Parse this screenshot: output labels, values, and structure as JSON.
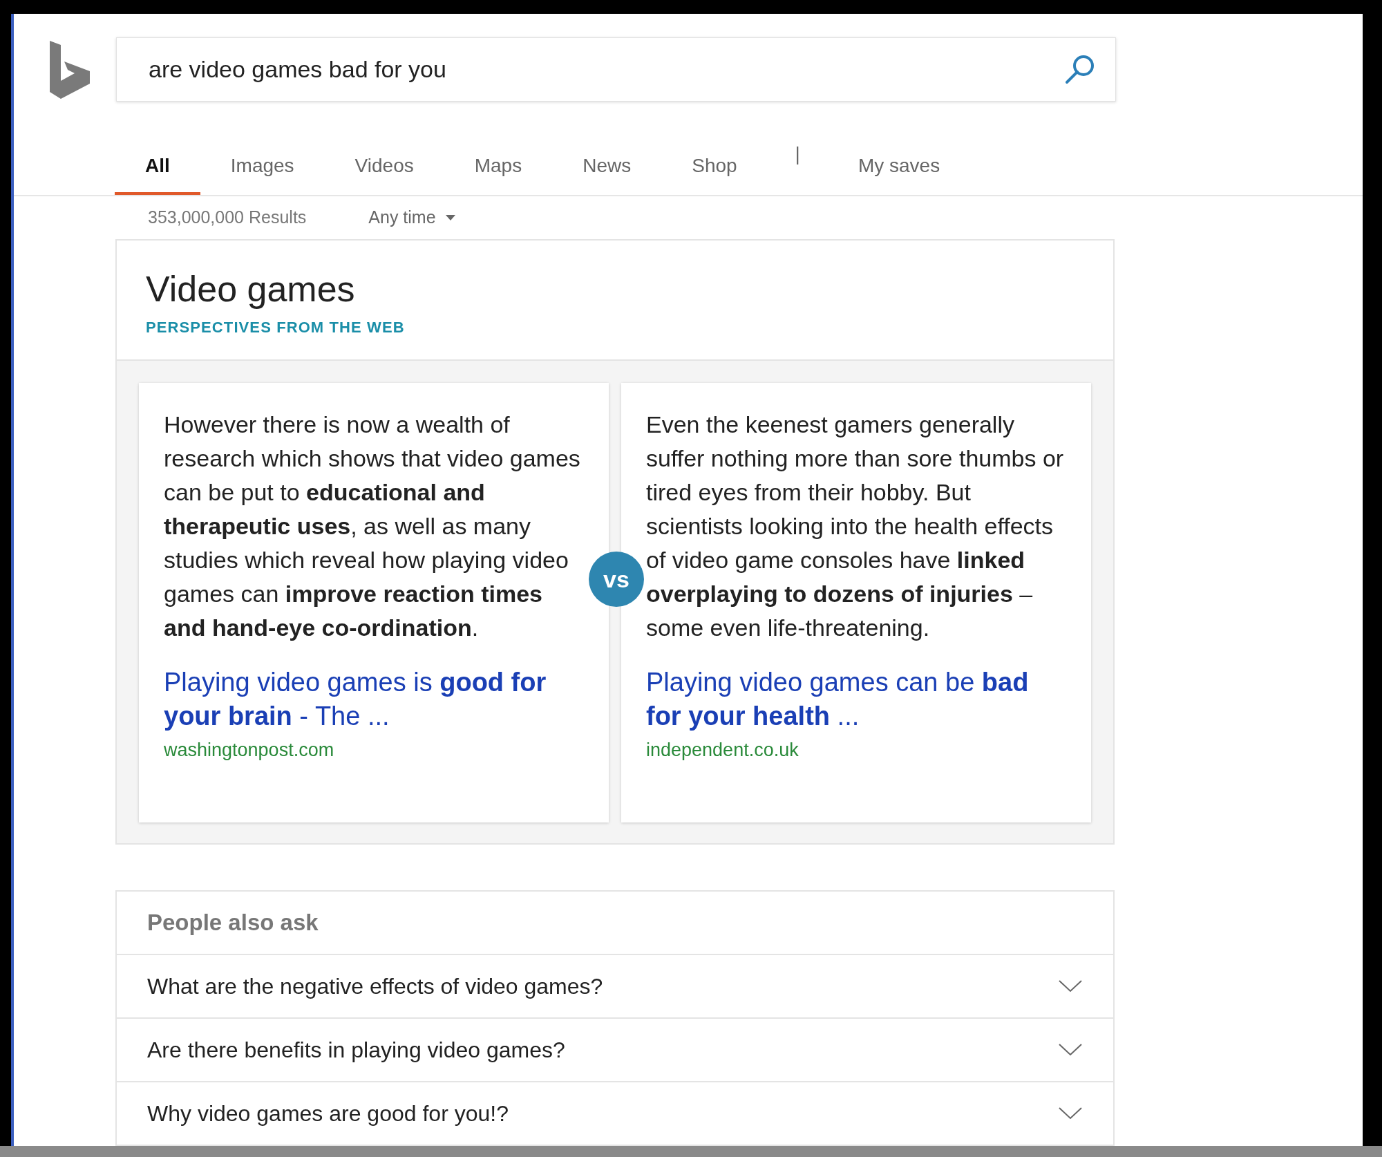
{
  "search": {
    "value": "are video games bad for you"
  },
  "tabs": [
    {
      "label": "All",
      "selected": true
    },
    {
      "label": "Images",
      "selected": false
    },
    {
      "label": "Videos",
      "selected": false
    },
    {
      "label": "Maps",
      "selected": false
    },
    {
      "label": "News",
      "selected": false
    },
    {
      "label": "Shop",
      "selected": false
    }
  ],
  "tab_separator": "|",
  "my_saves": "My saves",
  "results_count": "353,000,000 Results",
  "time_filter": "Any time",
  "perspectives": {
    "title": "Video games",
    "subtitle": "PERSPECTIVES FROM THE WEB",
    "vs_badge": "vs",
    "sides": [
      {
        "text": "However there is now a wealth of research which shows that video games can be put to **educational and therapeutic uses**, as well as many studies which reveal how playing video games can **improve reaction times and hand-eye co-ordination**.",
        "link": "Playing video games is **good for your brain** - The ...",
        "source": "washingtonpost.com"
      },
      {
        "text": "Even the keenest gamers generally suffer nothing more than sore thumbs or tired eyes from their hobby. But scientists looking into the health effects of video game consoles have **linked overplaying to dozens of injuries** – some even life-threatening.",
        "link": "Playing video games can be **bad for your health** ...",
        "source": "independent.co.uk"
      }
    ]
  },
  "people_also_ask": {
    "title": "People also ask",
    "questions": [
      {
        "text": "What are the negative effects of video games?",
        "expanded": false
      },
      {
        "text": "Are there benefits in playing video games?",
        "expanded": false
      },
      {
        "text": "Why video games are good for you!?",
        "expanded": false
      }
    ]
  }
}
